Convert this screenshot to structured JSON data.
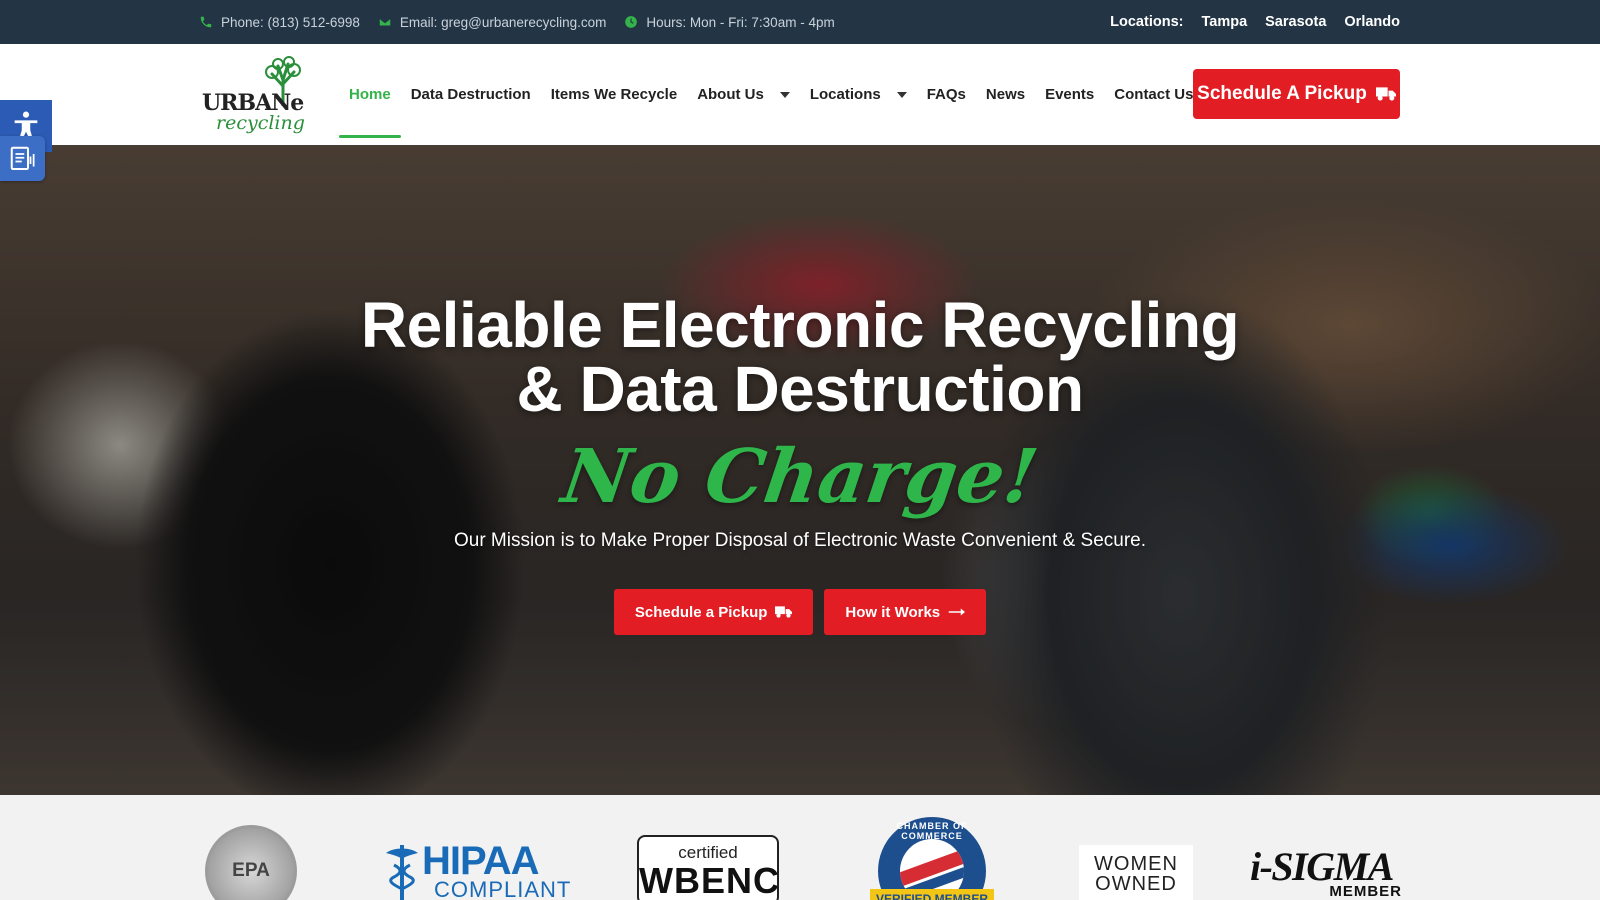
{
  "topbar": {
    "phone": "Phone: (813) 512-6998",
    "email": "Email: greg@urbanerecycling.com",
    "hours": "Hours: Mon - Fri: 7:30am - 4pm",
    "locations_label": "Locations:",
    "locations": [
      "Tampa",
      "Sarasota",
      "Orlando"
    ]
  },
  "logo": {
    "word1": "URBAN",
    "word1_end": "e",
    "word2": "recycling"
  },
  "nav": [
    {
      "label": "Home",
      "active": true
    },
    {
      "label": "Data Destruction"
    },
    {
      "label": "Items We Recycle"
    },
    {
      "label": "About Us",
      "dropdown": true
    },
    {
      "label": "Locations",
      "dropdown": true
    },
    {
      "label": "FAQs"
    },
    {
      "label": "News"
    },
    {
      "label": "Events"
    },
    {
      "label": "Contact Us"
    }
  ],
  "header_cta": "Schedule A Pickup",
  "hero": {
    "headline_line1": "Reliable Electronic Recycling",
    "headline_line2": "& Data Destruction",
    "tagline": "No Charge!",
    "mission": "Our Mission is to Make Proper Disposal of Electronic Waste Convenient & Secure.",
    "btn_schedule": "Schedule a Pickup",
    "btn_how": "How it Works"
  },
  "badges": {
    "epa": "EPA",
    "hipaa_1": "HIPAA",
    "hipaa_2": "COMPLIANT",
    "wbenc_1": "certified",
    "wbenc_2": "WBENC",
    "chamber_arc": "CHAMBER OF COMMERCE",
    "chamber_ribbon": "VERIFIED MEMBER",
    "women_1": "WOMEN",
    "women_2": "OWNED",
    "isigma_1": "i-SIGMA",
    "isigma_2": "MEMBER"
  },
  "colors": {
    "brand_green": "#34b34a",
    "cta_red": "#e21d24",
    "topbar": "#233545"
  }
}
